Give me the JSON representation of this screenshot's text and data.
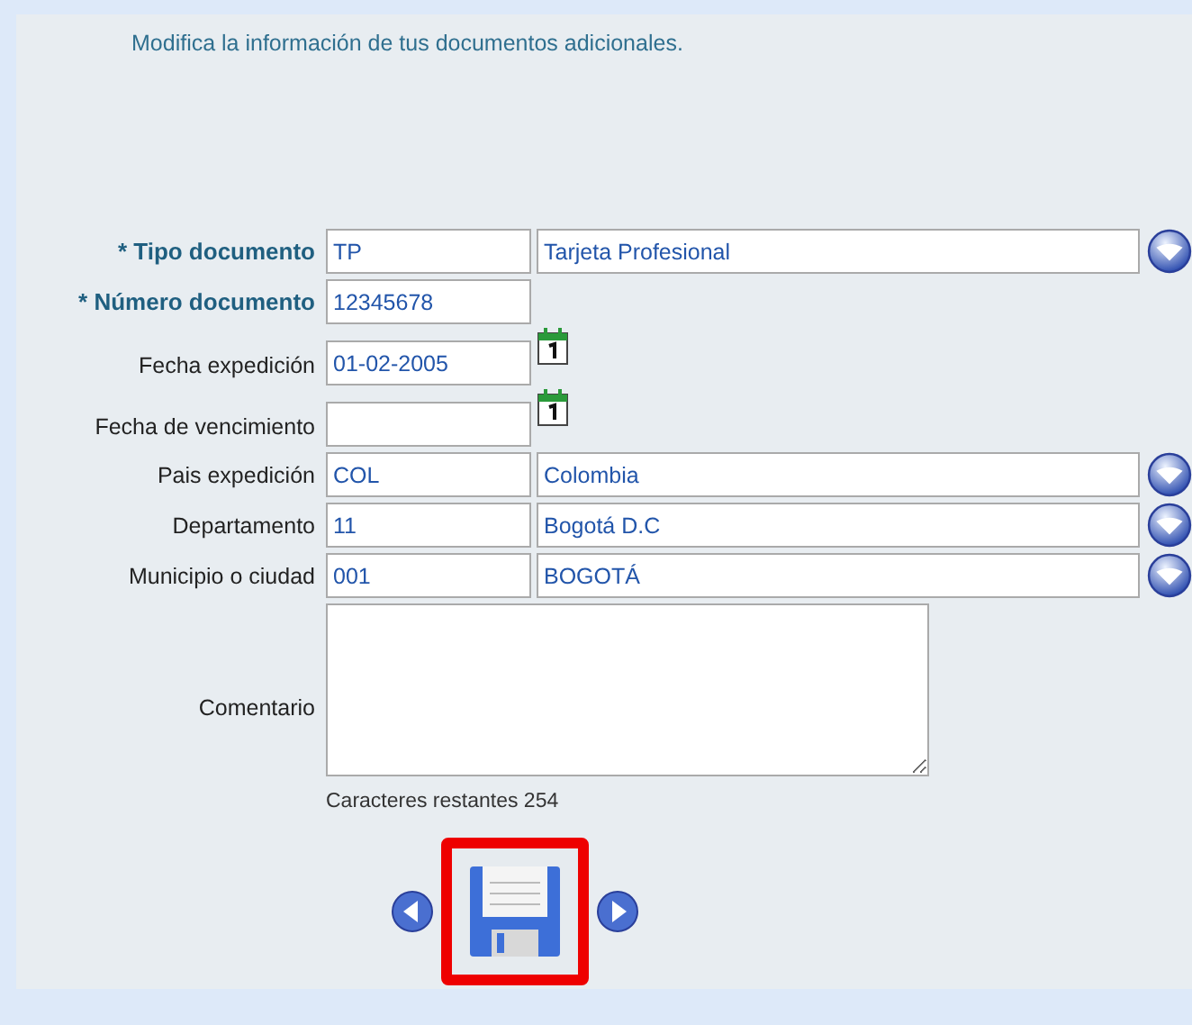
{
  "intro": "Modifica la información de tus documentos adicionales.",
  "fields": [
    {
      "kind": "lookup",
      "label": "* Tipo documento",
      "required": true,
      "code": "TP",
      "name": "Tarjeta Profesional"
    },
    {
      "kind": "single",
      "label": "* Número documento",
      "required": true,
      "code": "12345678"
    },
    {
      "kind": "date",
      "label": "Fecha expedición",
      "required": false,
      "code": "01-02-2005"
    },
    {
      "kind": "date",
      "label": "Fecha de vencimiento",
      "required": false
    },
    {
      "kind": "lookup",
      "label": "Pais expedición",
      "required": false,
      "code": "COL",
      "name": "Colombia"
    },
    {
      "kind": "lookup",
      "label": "Departamento",
      "required": false,
      "code": "11",
      "name": "Bogotá D.C"
    },
    {
      "kind": "lookup",
      "label": "Municipio o ciudad",
      "required": false,
      "code": "001",
      "name": "BOGOTÁ"
    }
  ],
  "comment": {
    "label": "Comentario",
    "counter": "Caracteres restantes 254"
  },
  "save": {
    "highlighted": true
  }
}
